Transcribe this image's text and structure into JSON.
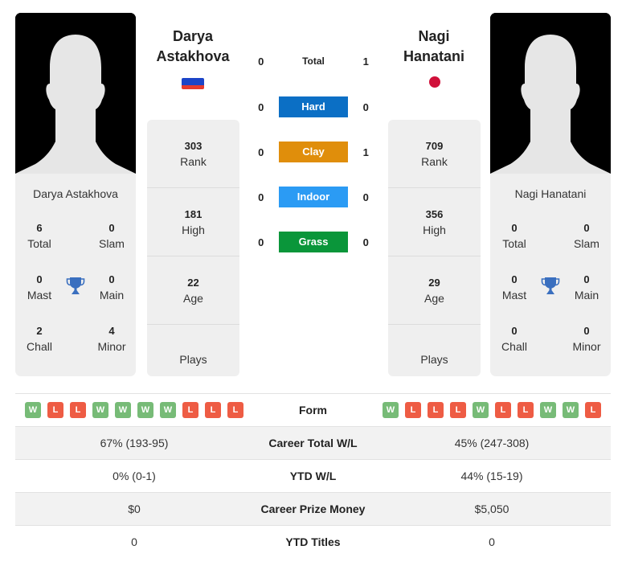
{
  "colors": {
    "hard": "#0b6fc5",
    "clay": "#e08e0b",
    "indoor": "#2b9bf4",
    "grass": "#0a963a",
    "win": "#77bb77",
    "loss": "#ee5c44",
    "trophy": "#3a6fbf",
    "flag_ru": [
      "#ffffff",
      "#1c45c8",
      "#e63b2e"
    ],
    "flag_jp": "#d0103a"
  },
  "player1": {
    "name_line1": "Darya",
    "name_line2": "Astakhova",
    "full_name": "Darya Astakhova",
    "country_flag": "russia-flag",
    "titles": {
      "total": {
        "value": "6",
        "label": "Total"
      },
      "slam": {
        "value": "0",
        "label": "Slam"
      },
      "mast": {
        "value": "0",
        "label": "Mast"
      },
      "main": {
        "value": "0",
        "label": "Main"
      },
      "chall": {
        "value": "2",
        "label": "Chall"
      },
      "minor": {
        "value": "4",
        "label": "Minor"
      }
    },
    "stats": {
      "rank": {
        "value": "303",
        "label": "Rank"
      },
      "high": {
        "value": "181",
        "label": "High"
      },
      "age": {
        "value": "22",
        "label": "Age"
      },
      "plays": {
        "value": "",
        "label": "Plays"
      }
    },
    "form": [
      "W",
      "L",
      "L",
      "W",
      "W",
      "W",
      "W",
      "L",
      "L",
      "L"
    ],
    "career_total_wl": "67% (193-95)",
    "ytd_wl": "0% (0-1)",
    "career_prize_money": "$0",
    "ytd_titles": "0"
  },
  "player2": {
    "name_line1": "Nagi",
    "name_line2": "Hanatani",
    "full_name": "Nagi Hanatani",
    "country_flag": "japan-flag",
    "titles": {
      "total": {
        "value": "0",
        "label": "Total"
      },
      "slam": {
        "value": "0",
        "label": "Slam"
      },
      "mast": {
        "value": "0",
        "label": "Mast"
      },
      "main": {
        "value": "0",
        "label": "Main"
      },
      "chall": {
        "value": "0",
        "label": "Chall"
      },
      "minor": {
        "value": "0",
        "label": "Minor"
      }
    },
    "stats": {
      "rank": {
        "value": "709",
        "label": "Rank"
      },
      "high": {
        "value": "356",
        "label": "High"
      },
      "age": {
        "value": "29",
        "label": "Age"
      },
      "plays": {
        "value": "",
        "label": "Plays"
      }
    },
    "form": [
      "W",
      "L",
      "L",
      "L",
      "W",
      "L",
      "L",
      "W",
      "W",
      "L"
    ],
    "career_total_wl": "45% (247-308)",
    "ytd_wl": "44% (15-19)",
    "career_prize_money": "$5,050",
    "ytd_titles": "0"
  },
  "h2h": {
    "total": {
      "label": "Total",
      "p1": "0",
      "p2": "1"
    },
    "surfaces": [
      {
        "key": "hard",
        "label": "Hard",
        "p1": "0",
        "p2": "0"
      },
      {
        "key": "clay",
        "label": "Clay",
        "p1": "0",
        "p2": "1"
      },
      {
        "key": "indoor",
        "label": "Indoor",
        "p1": "0",
        "p2": "0"
      },
      {
        "key": "grass",
        "label": "Grass",
        "p1": "0",
        "p2": "0"
      }
    ]
  },
  "compare_labels": {
    "form": "Form",
    "career_total_wl": "Career Total W/L",
    "ytd_wl": "YTD W/L",
    "career_prize_money": "Career Prize Money",
    "ytd_titles": "YTD Titles"
  }
}
